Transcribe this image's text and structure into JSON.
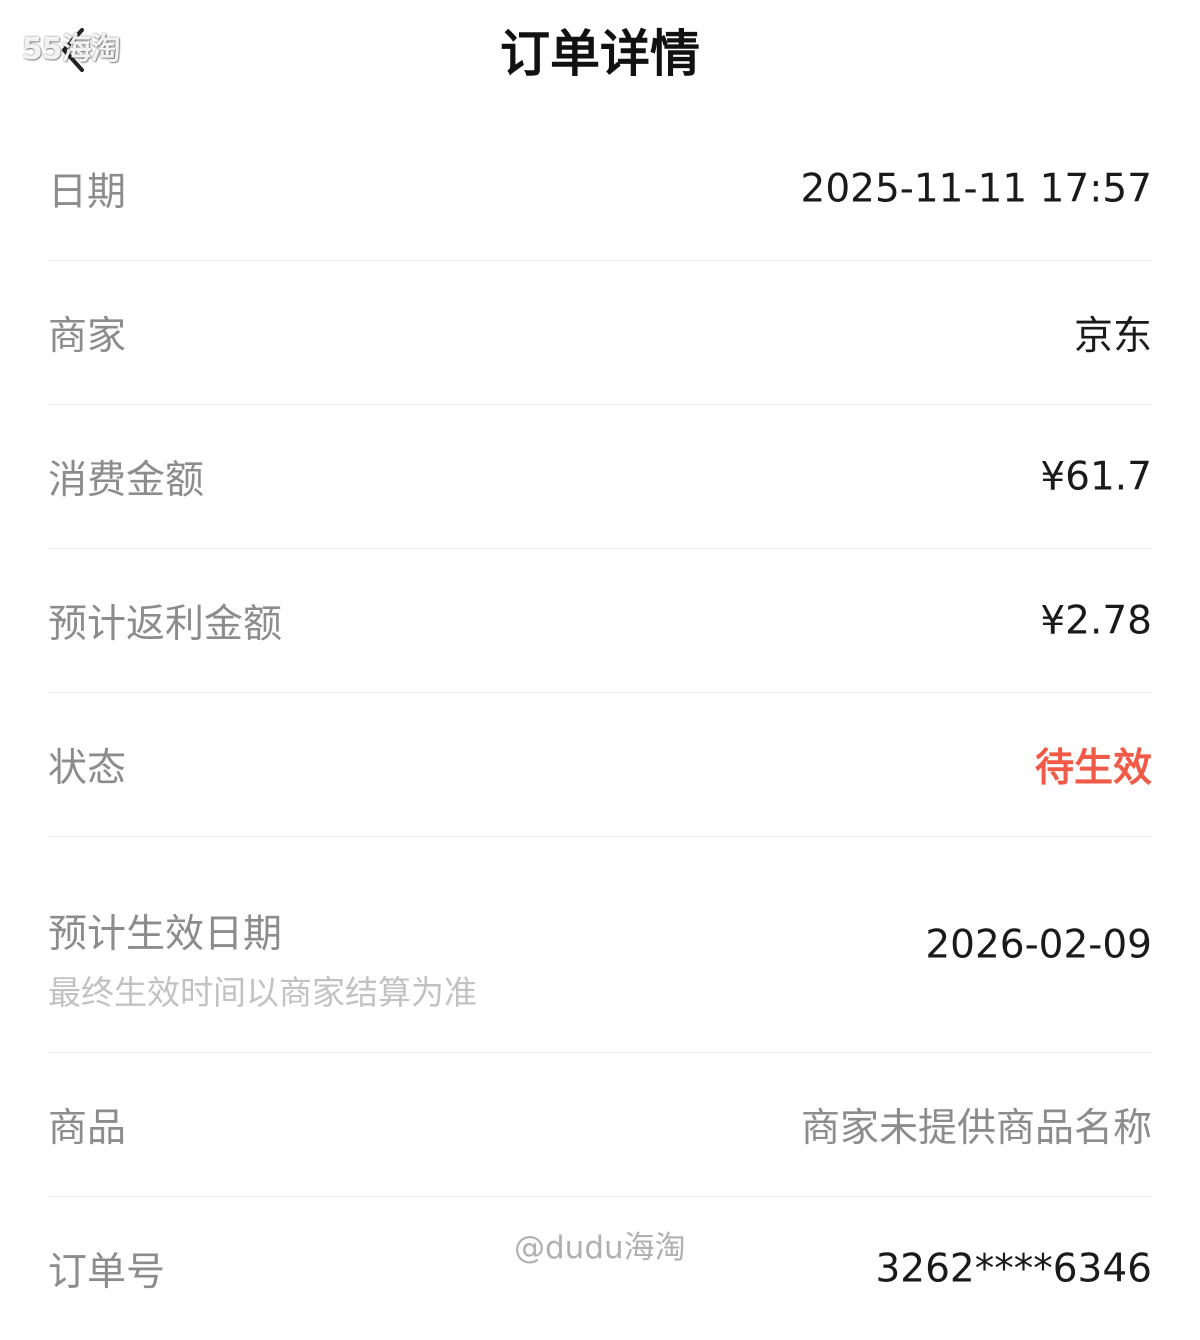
{
  "header": {
    "title": "订单详情",
    "watermark": "55海淘"
  },
  "rows": [
    {
      "label": "日期",
      "value": "2025-11-11 17:57"
    },
    {
      "label": "商家",
      "value": "京东"
    },
    {
      "label": "消费金额",
      "value": "¥61.7"
    },
    {
      "label": "预计返利金额",
      "value": "¥2.78"
    },
    {
      "label": "状态",
      "value": "待生效"
    },
    {
      "label": "预计生效日期",
      "sublabel": "最终生效时间以商家结算为准",
      "value": "2026-02-09"
    },
    {
      "label": "商品",
      "value": "商家未提供商品名称"
    },
    {
      "label": "订单号",
      "value": "3262****6346"
    }
  ],
  "footer": {
    "watermark": "@dudu海淘"
  },
  "colors": {
    "status": "#f25a48",
    "label": "#8c8c8c",
    "sublabel": "#c2c2c2",
    "value": "#1a1a1a",
    "divider": "#ebebeb"
  },
  "icons": {
    "back": "chevron-left-icon"
  }
}
